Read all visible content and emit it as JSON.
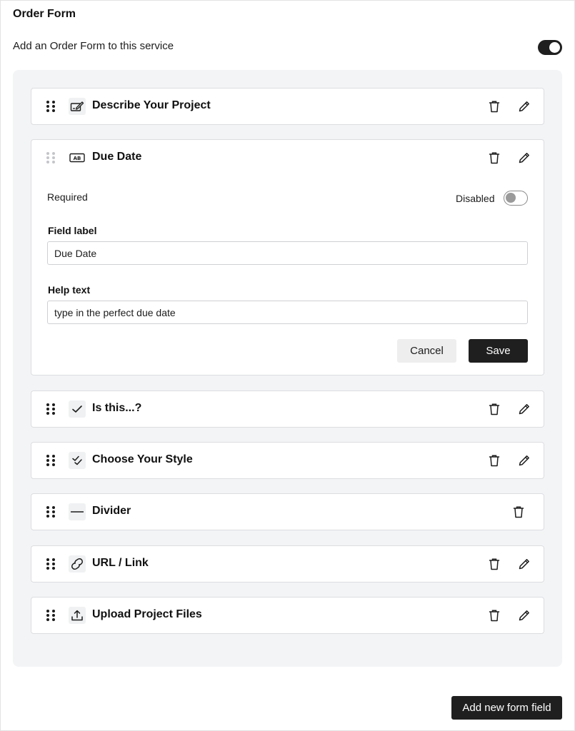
{
  "header": {
    "title": "Order Form",
    "enable_label": "Add an Order Form to this service",
    "enable_toggle_on": true
  },
  "fields": [
    {
      "title": "Describe Your Project",
      "icon": "edit-box-icon"
    },
    {
      "title": "Due Date",
      "icon": "text-field-icon",
      "expanded": true
    },
    {
      "title": "Is this...?",
      "icon": "check-icon"
    },
    {
      "title": "Choose Your Style",
      "icon": "double-check-icon"
    },
    {
      "title": "Divider",
      "icon": "divider-line-icon"
    },
    {
      "title": "URL / Link",
      "icon": "link-icon"
    },
    {
      "title": "Upload Project Files",
      "icon": "upload-icon"
    }
  ],
  "editor": {
    "required_label": "Required",
    "disabled_label": "Disabled",
    "field_label_title": "Field label",
    "field_label_value": "Due Date",
    "help_text_title": "Help text",
    "help_text_value": "type in the perfect due date",
    "cancel_label": "Cancel",
    "save_label": "Save"
  },
  "footer": {
    "add_field_label": "Add new form field"
  },
  "colors": {
    "primary": "#1f1f1f",
    "panel_bg": "#f3f4f6",
    "card_border": "#dcdde0"
  }
}
